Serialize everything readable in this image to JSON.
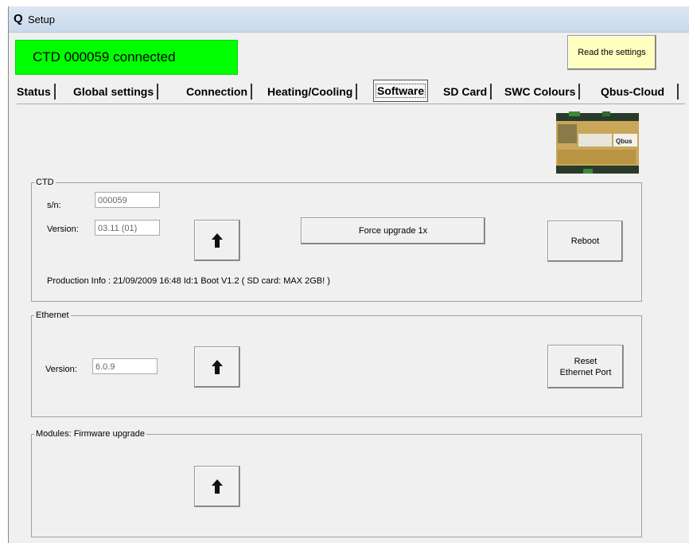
{
  "window": {
    "title": "Setup",
    "icon": "qbus-q-icon"
  },
  "status": {
    "text": "CTD 000059 connected",
    "color": "#00ff00"
  },
  "header": {
    "read_button": "Read the settings"
  },
  "tabs": [
    {
      "label": "Status",
      "active": false
    },
    {
      "label": "Global settings",
      "active": false
    },
    {
      "label": "Connection",
      "active": false
    },
    {
      "label": "Heating/Cooling",
      "active": false
    },
    {
      "label": "Software",
      "active": true
    },
    {
      "label": "SD Card",
      "active": false
    },
    {
      "label": "SWC Colours",
      "active": false
    },
    {
      "label": "Qbus-Cloud",
      "active": false
    }
  ],
  "device_image": {
    "brand": "Qbus"
  },
  "ctd": {
    "legend": "CTD",
    "sn_label": "s/n:",
    "sn_value": "000059",
    "version_label": "Version:",
    "version_value": "03.11 (01)",
    "force_upgrade": "Force upgrade 1x",
    "reboot": "Reboot",
    "production_info": "Production Info : 21/09/2009 16:48   Id:1   Boot V1.2  ( SD card: MAX 2GB! )"
  },
  "ethernet": {
    "legend": "Ethernet",
    "version_label": "Version:",
    "version_value": "6.0.9",
    "reset_line1": "Reset",
    "reset_line2": "Ethernet Port"
  },
  "modules": {
    "legend": "Modules: Firmware upgrade"
  }
}
